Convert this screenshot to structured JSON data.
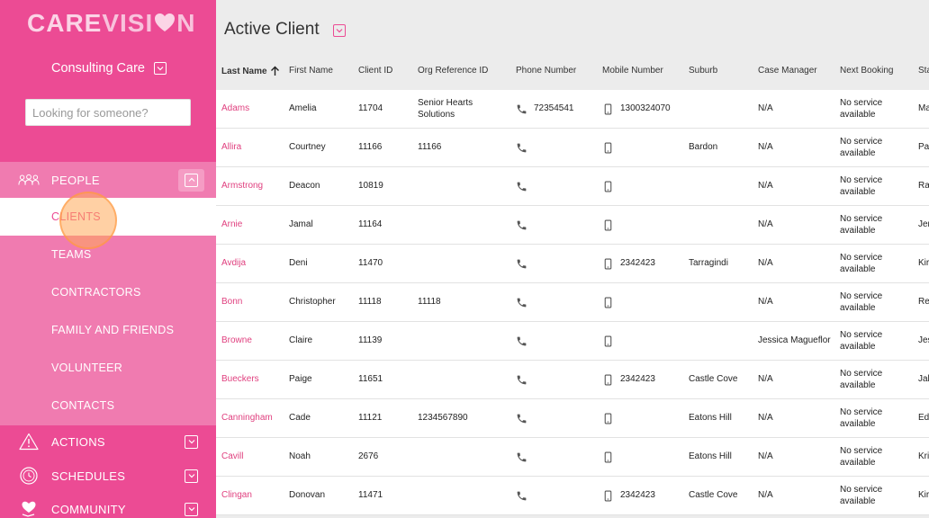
{
  "app": {
    "logo_a": "CARE",
    "logo_b": "VISI",
    "logo_c": "N"
  },
  "org": {
    "name": "Consulting Care"
  },
  "search": {
    "placeholder": "Looking for someone?"
  },
  "nav": {
    "people": "PEOPLE",
    "people_items": [
      "CLIENTS",
      "TEAMS",
      "CONTRACTORS",
      "FAMILY AND FRIENDS",
      "VOLUNTEER",
      "CONTACTS"
    ],
    "active": "CLIENTS",
    "actions": "ACTIONS",
    "schedules": "SCHEDULES",
    "community": "COMMUNITY"
  },
  "page": {
    "title": "Active Client"
  },
  "colors": {
    "brand": "#ec4b94",
    "brand_light": "#f07bb0",
    "link": "#e0407f"
  },
  "table": {
    "columns": [
      "Last Name",
      "First Name",
      "Client ID",
      "Org Reference ID",
      "Phone Number",
      "Mobile Number",
      "Suburb",
      "Case Manager",
      "Next Booking",
      "Sta"
    ],
    "sorted_column": "Last Name",
    "rows": [
      {
        "last": "Adams",
        "first": "Amelia",
        "id": "11704",
        "org_ref": "Senior Hearts Solutions",
        "phone": "72354541",
        "mobile": "1300324070",
        "suburb": "",
        "case_manager": "N/A",
        "next_booking": "No service available",
        "status": "Ma"
      },
      {
        "last": "Allira",
        "first": "Courtney",
        "id": "11166",
        "org_ref": "11166",
        "phone": "",
        "mobile": "",
        "suburb": "Bardon",
        "case_manager": "N/A",
        "next_booking": "No service available",
        "status": "Pa"
      },
      {
        "last": "Armstrong",
        "first": "Deacon",
        "id": "10819",
        "org_ref": "",
        "phone": "",
        "mobile": "",
        "suburb": "",
        "case_manager": "N/A",
        "next_booking": "No service available",
        "status": "Ra"
      },
      {
        "last": "Arnie",
        "first": "Jamal",
        "id": "11164",
        "org_ref": "",
        "phone": "",
        "mobile": "",
        "suburb": "",
        "case_manager": "N/A",
        "next_booking": "No service available",
        "status": "Jer"
      },
      {
        "last": "Avdija",
        "first": "Deni",
        "id": "11470",
        "org_ref": "",
        "phone": "",
        "mobile": "2342423",
        "suburb": "Tarragindi",
        "case_manager": "N/A",
        "next_booking": "No service available",
        "status": "Kir"
      },
      {
        "last": "Bonn",
        "first": "Christopher",
        "id": "11118",
        "org_ref": "11118",
        "phone": "",
        "mobile": "",
        "suburb": "",
        "case_manager": "N/A",
        "next_booking": "No service available",
        "status": "Re"
      },
      {
        "last": "Browne",
        "first": "Claire",
        "id": "11139",
        "org_ref": "",
        "phone": "",
        "mobile": "",
        "suburb": "",
        "case_manager": "Jessica Magueflor",
        "next_booking": "No service available",
        "status": "Jes"
      },
      {
        "last": "Bueckers",
        "first": "Paige",
        "id": "11651",
        "org_ref": "",
        "phone": "",
        "mobile": "2342423",
        "suburb": "Castle Cove",
        "case_manager": "N/A",
        "next_booking": "No service available",
        "status": "Jal"
      },
      {
        "last": "Canningham",
        "first": "Cade",
        "id": "11121",
        "org_ref": "1234567890",
        "phone": "",
        "mobile": "",
        "suburb": "Eatons Hill",
        "case_manager": "N/A",
        "next_booking": "No service available",
        "status": "Ed"
      },
      {
        "last": "Cavill",
        "first": "Noah",
        "id": "2676",
        "org_ref": "",
        "phone": "",
        "mobile": "",
        "suburb": "Eatons Hill",
        "case_manager": "N/A",
        "next_booking": "No service available",
        "status": "Kri"
      },
      {
        "last": "Clingan",
        "first": "Donovan",
        "id": "11471",
        "org_ref": "",
        "phone": "",
        "mobile": "2342423",
        "suburb": "Castle Cove",
        "case_manager": "N/A",
        "next_booking": "No service available",
        "status": "Kir"
      }
    ]
  }
}
